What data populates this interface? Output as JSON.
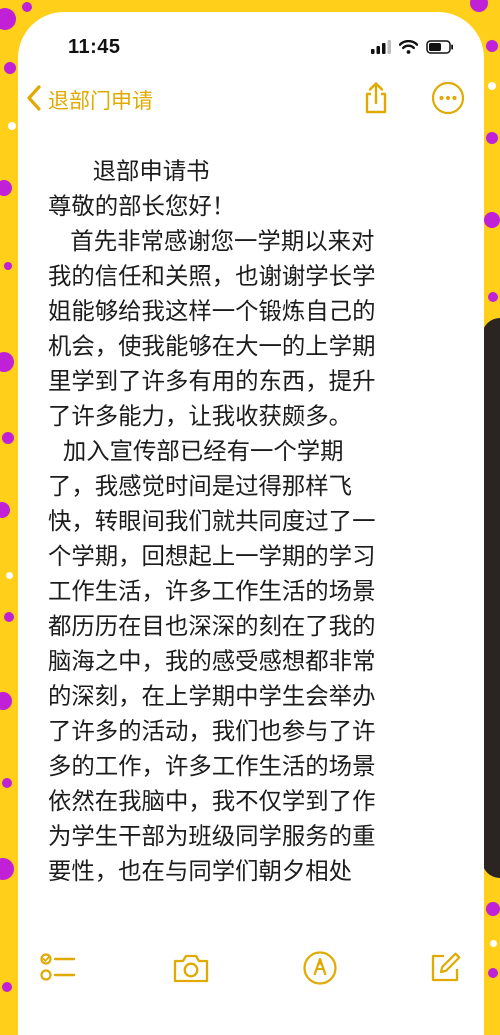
{
  "status_bar": {
    "time": "11:45"
  },
  "nav": {
    "back_label": "退部门申请"
  },
  "note": {
    "lines": [
      "      退部申请书",
      "尊敬的部长您好！",
      "   首先非常感谢您一学期以来对",
      "我的信任和关照，也谢谢学长学",
      "姐能够给我这样一个锻炼自己的",
      "机会，使我能够在大一的上学期",
      "里学到了许多有用的东西，提升",
      "了许多能力，让我收获颇多。",
      "  加入宣传部已经有一个学期",
      "了，我感觉时间是过得那样飞",
      "快，转眼间我们就共同度过了一",
      "个学期，回想起上一学期的学习",
      "工作生活，许多工作生活的场景",
      "都历历在目也深深的刻在了我的",
      "脑海之中，我的感受感想都非常",
      "的深刻，在上学期中学生会举办",
      "了许多的活动，我们也参与了许",
      "多的工作，许多工作生活的场景",
      "依然在我脑中，我不仅学到了作",
      "为学生干部为班级同学服务的重",
      "要性，也在与同学们朝夕相处"
    ]
  },
  "icons": {
    "back": "chevron-left-icon",
    "share": "share-icon",
    "more": "more-icon",
    "signal": "signal-icon",
    "wifi": "wifi-icon",
    "battery": "battery-icon",
    "checklist": "checklist-icon",
    "camera": "camera-icon",
    "markup": "markup-icon",
    "compose": "compose-icon"
  },
  "colors": {
    "accent": "#e0aa00",
    "background_yellow": "#ffcf1a",
    "dot_purple": "#c021d6",
    "text": "#1c1c1c"
  }
}
